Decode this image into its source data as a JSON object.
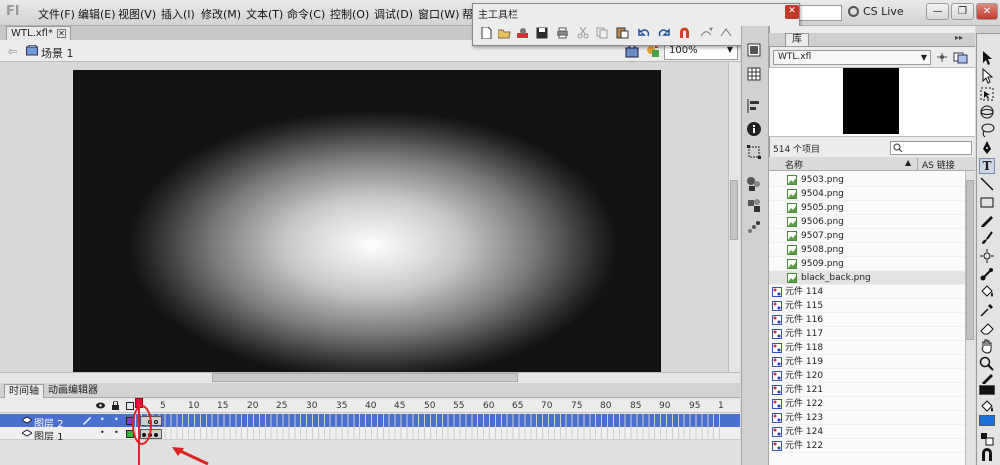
{
  "app": {
    "menus": [
      "文件(F)",
      "编辑(E)",
      "视图(V)",
      "插入(I)",
      "修改(M)",
      "文本(T)",
      "命令(C)",
      "控制(O)",
      "调试(D)",
      "窗口(W)",
      "帮"
    ],
    "cs_live": "CS Live"
  },
  "document": {
    "tab_label": "WTL.xfl*",
    "scene_label": "场景 1",
    "zoom": "100%"
  },
  "main_toolbar": {
    "title": "主工具栏"
  },
  "timeline": {
    "tab_timeline": "时间轴",
    "tab_motion": "动画编辑器",
    "frame_numbers": [
      "1",
      "5",
      "10",
      "15",
      "20",
      "25",
      "30",
      "35",
      "40",
      "45",
      "50",
      "55",
      "60",
      "65",
      "70",
      "75",
      "80",
      "85",
      "90",
      "95",
      "1"
    ],
    "layers": [
      {
        "name": "图层 2",
        "selected": true
      },
      {
        "name": "图层 1",
        "selected": false
      }
    ]
  },
  "library": {
    "tab_label": "库",
    "doc_select": "WTL.xfl",
    "item_count": "514 个项目",
    "col_name": "名称",
    "col_linkage": "AS 链接",
    "items": [
      {
        "name": "9503.png",
        "type": "bitmap"
      },
      {
        "name": "9504.png",
        "type": "bitmap"
      },
      {
        "name": "9505.png",
        "type": "bitmap"
      },
      {
        "name": "9506.png",
        "type": "bitmap"
      },
      {
        "name": "9507.png",
        "type": "bitmap"
      },
      {
        "name": "9508.png",
        "type": "bitmap"
      },
      {
        "name": "9509.png",
        "type": "bitmap"
      },
      {
        "name": "black_back.png",
        "type": "bitmap"
      },
      {
        "name": "元件 114",
        "type": "symbol"
      },
      {
        "name": "元件 115",
        "type": "symbol"
      },
      {
        "name": "元件 116",
        "type": "symbol"
      },
      {
        "name": "元件 117",
        "type": "symbol"
      },
      {
        "name": "元件 118",
        "type": "symbol"
      },
      {
        "name": "元件 119",
        "type": "symbol"
      },
      {
        "name": "元件 120",
        "type": "symbol"
      },
      {
        "name": "元件 121",
        "type": "symbol"
      },
      {
        "name": "元件 122",
        "type": "symbol"
      },
      {
        "name": "元件 123",
        "type": "symbol"
      },
      {
        "name": "元件 124",
        "type": "symbol"
      },
      {
        "name": "元件 122",
        "type": "symbol"
      }
    ]
  },
  "icons": {
    "tools": [
      "selection-tool-icon",
      "subselection-tool-icon",
      "free-transform-tool-icon",
      "3d-rotation-tool-icon",
      "lasso-tool-icon",
      "pen-tool-icon",
      "text-tool-icon",
      "line-tool-icon",
      "rectangle-tool-icon",
      "pencil-tool-icon",
      "brush-tool-icon",
      "deco-tool-icon",
      "bone-tool-icon",
      "paint-bucket-tool-icon",
      "eyedropper-tool-icon",
      "eraser-tool-icon",
      "hand-tool-icon",
      "zoom-tool-icon"
    ]
  },
  "colors": {
    "layer_selected": "#4b6fd0",
    "fill_color": "#1a6fd8",
    "stroke_color": "#111111",
    "playhead": "#dd2233"
  }
}
